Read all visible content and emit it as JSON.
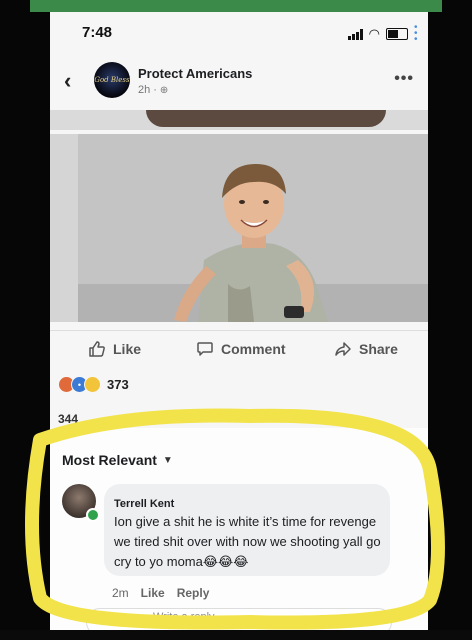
{
  "status_bar": {
    "time": "7:48"
  },
  "post": {
    "page_name": "Protect Americans",
    "avatar_text": "God Bless",
    "age": "2h",
    "age_separator": "·"
  },
  "actions": {
    "like": "Like",
    "comment": "Comment",
    "share": "Share"
  },
  "reactions": {
    "count": "373"
  },
  "comments": {
    "cut_count": "344",
    "sort_label": "Most Relevant",
    "items": [
      {
        "name": "Terrell Kent",
        "text": "Ion give a shit he is white it’s time for revenge we tired shit over with now we shooting yall go cry to yo moma😂😂😂",
        "time": "2m",
        "like": "Like",
        "reply": "Reply"
      }
    ],
    "reply_placeholder": "Write a reply..."
  },
  "colors": {
    "highlight": "#f2e34a",
    "accent": "#3c8a4a"
  }
}
